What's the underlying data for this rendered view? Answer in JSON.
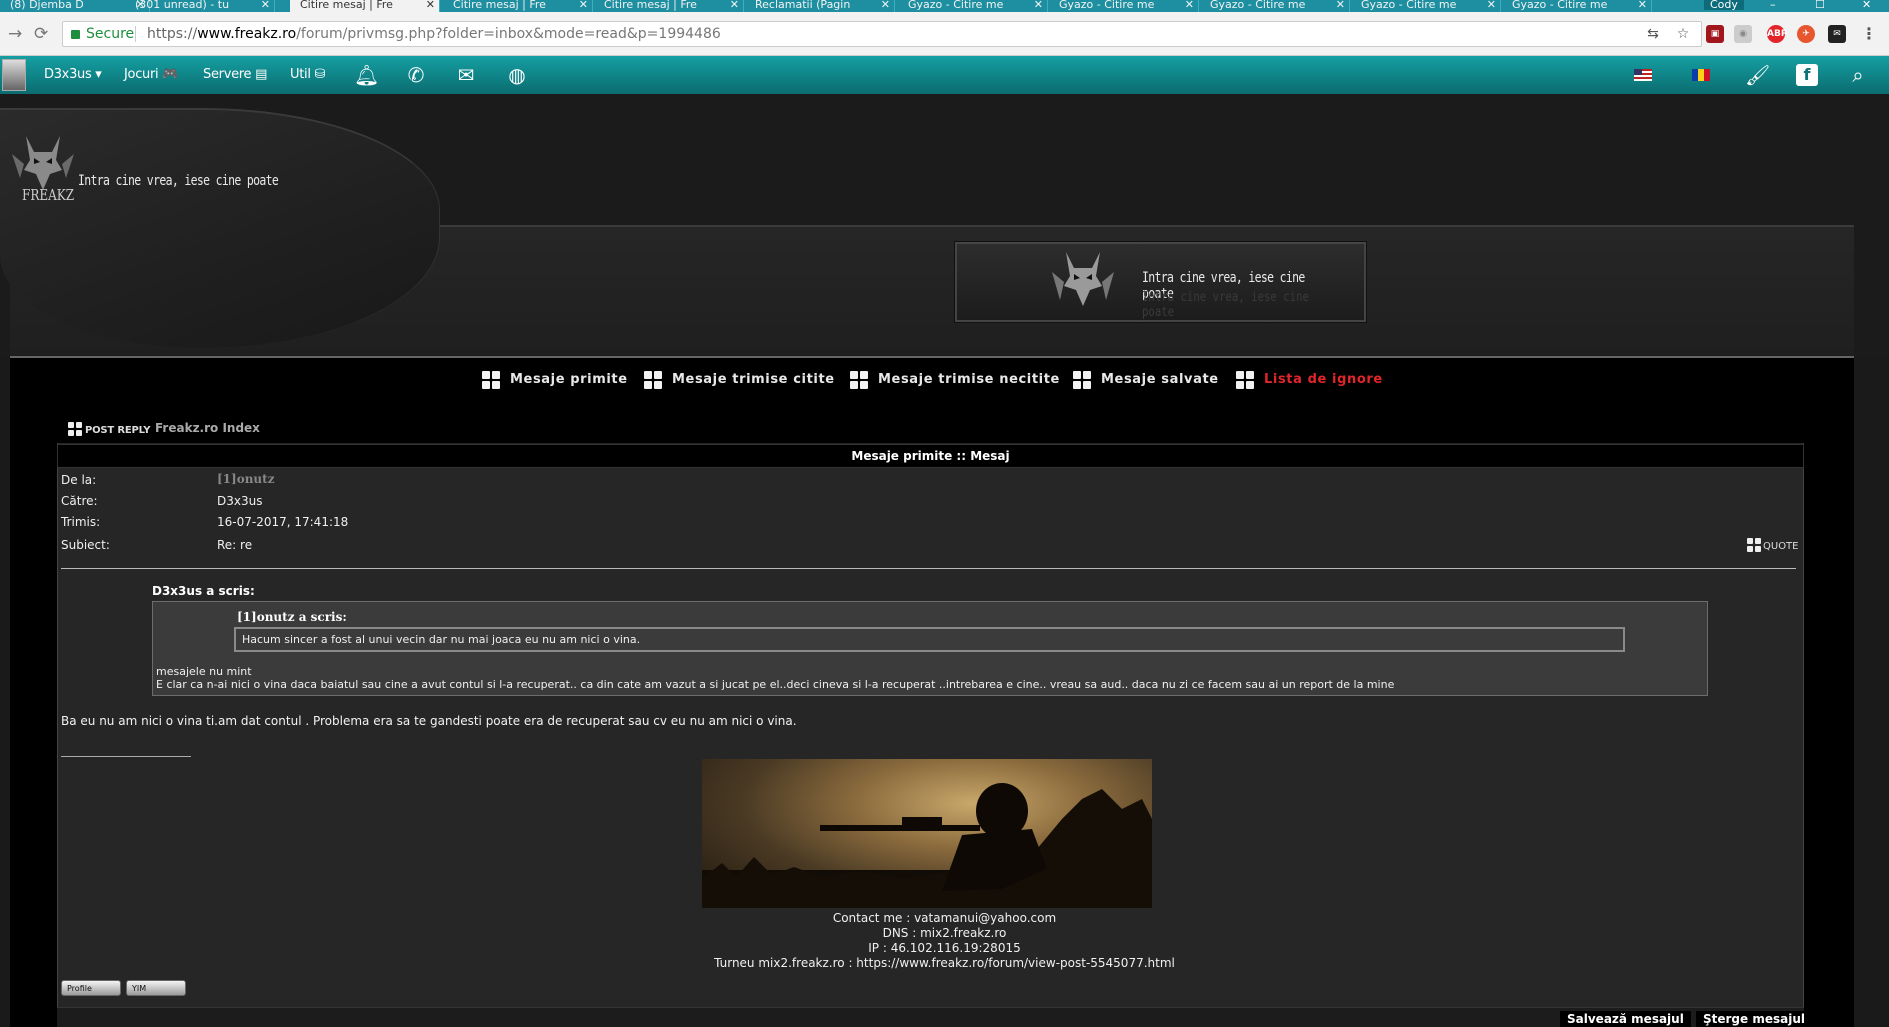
{
  "browser": {
    "tabs": [
      {
        "title": "(8) Djemba D",
        "active": false
      },
      {
        "title": "(301 unread) - tu",
        "active": false
      },
      {
        "title": "Citire mesaj | Fre",
        "active": true
      },
      {
        "title": "Citire mesaj | Fre",
        "active": false
      },
      {
        "title": "Citire mesaj | Fre",
        "active": false
      },
      {
        "title": "Reclamatii (Pagin",
        "active": false
      },
      {
        "title": "Gyazo - Citire me",
        "active": false
      },
      {
        "title": "Gyazo - Citire me",
        "active": false
      },
      {
        "title": "Gyazo - Citire me",
        "active": false
      },
      {
        "title": "Gyazo - Citire me",
        "active": false
      },
      {
        "title": "Gyazo - Citire me",
        "active": false
      }
    ],
    "tab_close": "✕",
    "user_chip": "Cody",
    "secure_label": "Secure",
    "url_scheme": "https://",
    "url_domain": "www.freakz.ro",
    "url_path": "/forum/privmsg.php?folder=inbox&mode=read&p=1994486",
    "ext_badge": "ABP"
  },
  "sitebar": {
    "items": [
      {
        "label": "D3x3us ▾"
      },
      {
        "label": "Jocuri 🎮"
      },
      {
        "label": "Servere ▤"
      },
      {
        "label": "Util ⛁"
      }
    ],
    "icons": [
      "bell-icon",
      "phone-icon",
      "envelope-icon",
      "globe-icon",
      "brush-icon",
      "facebook-icon",
      "search-icon"
    ]
  },
  "header": {
    "slogan": "Intra cine vrea, iese cine poate",
    "brand": "FREAKZ"
  },
  "pm_nav": [
    {
      "label": "Mesaje primite"
    },
    {
      "label": "Mesaje trimise citite"
    },
    {
      "label": "Mesaje trimise necitite"
    },
    {
      "label": "Mesaje salvate"
    },
    {
      "label": "Lista de ignore"
    }
  ],
  "toolbar": {
    "post_reply": "POST REPLY",
    "breadcrumb": "Freakz.ro Index"
  },
  "message": {
    "header": "Mesaje primite :: Mesaj",
    "labels": {
      "from": "De la:",
      "to": "Către:",
      "sent": "Trimis:",
      "subject": "Subiect:"
    },
    "from": "[1]onutz",
    "to": "D3x3us",
    "sent": "16-07-2017, 17:41:18",
    "subject": "Re: re",
    "quote_label": "QUOTE",
    "quote_author": "D3x3us a scris:",
    "inner_quote_author": "[1]onutz a scris:",
    "inner_quote_text": "Hacum sincer a fost al unui vecin dar nu mai joaca eu nu am nici o vina.",
    "quote_line1": "mesajele nu mint",
    "quote_line2": "E clar ca n-ai nici o vina daca baiatul sau cine a avut contul si l-a recuperat.. ca din cate am vazut a si jucat pe el..deci cineva si l-a recuperat ..intrebarea e cine.. vreau sa aud.. daca nu zi ce facem sau ai un report de la mine",
    "body": "Ba eu nu am nici o vina ti.am dat contul . Problema era sa te gandesti poate era de recuperat sau cv eu nu am nici o vina.",
    "signature_lines": [
      "Contact me : vatamanui@yahoo.com",
      "DNS : mix2.freakz.ro",
      "IP : 46.102.116.19:28015",
      "Turneu mix2.freakz.ro : https://www.freakz.ro/forum/view-post-5545077.html"
    ]
  },
  "buttons": {
    "profile": "Profile",
    "yim": "YIM",
    "save": "Salvează mesajul",
    "delete": "Şterge mesajul"
  },
  "colors": {
    "sitebar": "#159fa2",
    "tabbar": "#1e8fa0",
    "ignore_link": "#e2242b",
    "page_bg": "#1a1a1a"
  }
}
